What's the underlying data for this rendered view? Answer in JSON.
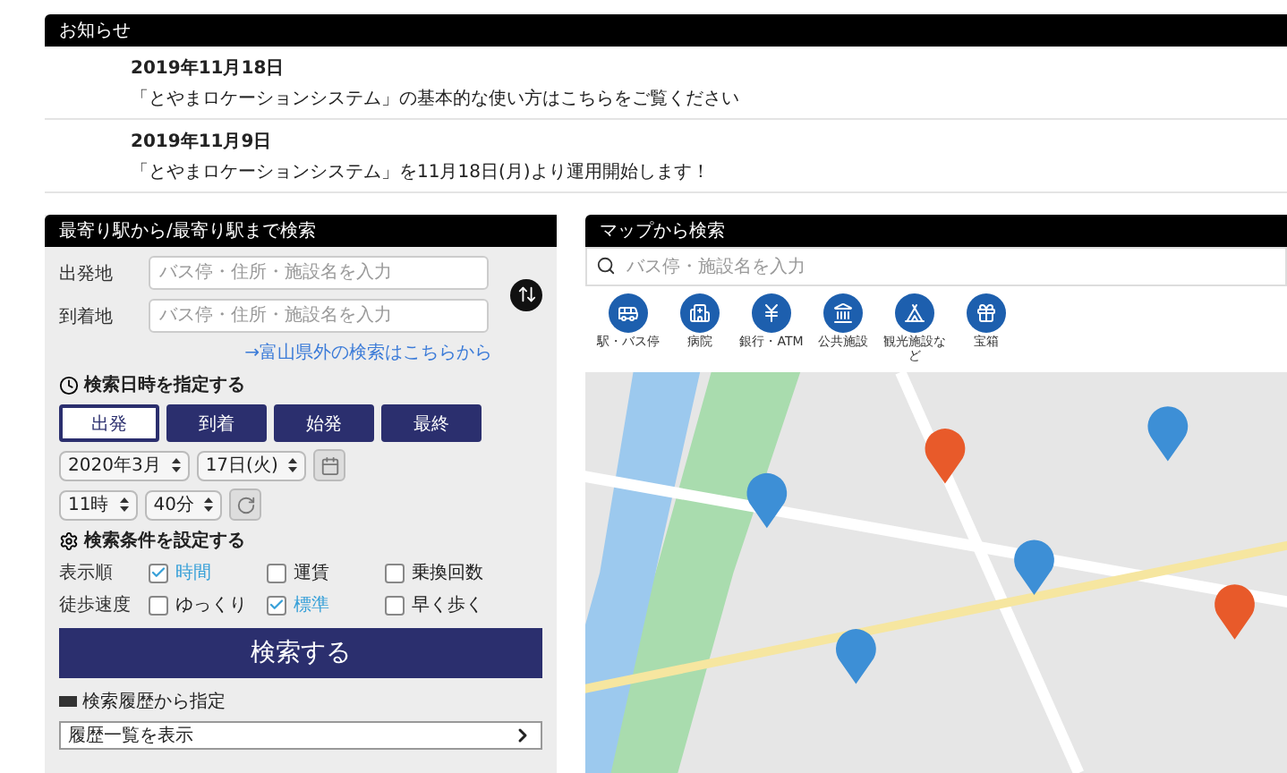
{
  "notices": {
    "title": "お知らせ",
    "items": [
      {
        "date": "2019年11月18日",
        "text": "「とやまロケーションシステム」の基本的な使い方はこちらをご覧ください"
      },
      {
        "date": "2019年11月9日",
        "text": "「とやまロケーションシステム」を11月18日(月)より運用開始します！"
      }
    ]
  },
  "route_search": {
    "title": "最寄り駅から/最寄り駅まで検索",
    "fields": [
      {
        "label": "出発地",
        "placeholder": "バス停・住所・施設名を入力"
      },
      {
        "label": "到着地",
        "placeholder": "バス停・住所・施設名を入力"
      }
    ],
    "outside_link": "→富山県外の検索はこちらから",
    "time_heading": "検索日時を指定する",
    "time_modes": [
      {
        "label": "出発",
        "selected": true
      },
      {
        "label": "到着",
        "selected": false
      },
      {
        "label": "始発",
        "selected": false
      },
      {
        "label": "最終",
        "selected": false
      }
    ],
    "date_selects": [
      "2020年3月",
      "17日(火)"
    ],
    "time_selects": [
      "11時",
      "40分"
    ],
    "conditions_heading": "検索条件を設定する",
    "option_rows": [
      {
        "label": "表示順",
        "options": [
          {
            "label": "時間",
            "checked": true
          },
          {
            "label": "運賃",
            "checked": false
          },
          {
            "label": "乗換回数",
            "checked": false
          }
        ]
      },
      {
        "label": "徒歩速度",
        "options": [
          {
            "label": "ゆっくり",
            "checked": false
          },
          {
            "label": "標準",
            "checked": true
          },
          {
            "label": "早く歩く",
            "checked": false
          }
        ]
      }
    ],
    "search_button": "検索する",
    "history_heading": "検索履歴から指定",
    "history_button": "履歴一覧を表示"
  },
  "map_search": {
    "title": "マップから検索",
    "placeholder": "バス停・施設名を入力",
    "categories": [
      "駅・バス停",
      "病院",
      "銀行・ATM",
      "公共施設",
      "観光施設など",
      "宝箱"
    ]
  }
}
